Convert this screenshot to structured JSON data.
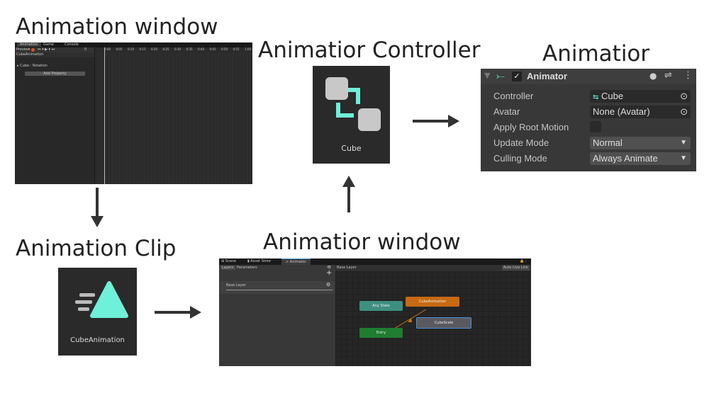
{
  "titles": {
    "animation_window": "Animation window",
    "controller": "Animatior Controller",
    "animator": "Animatior",
    "clip": "Animation Clip",
    "animator_window": "Animatior window"
  },
  "animation_window": {
    "tabs": [
      "Animation",
      "Game",
      "Console"
    ],
    "preview": "Preview",
    "frame": "0",
    "clip_name": "CubeAnimation",
    "property": "Cube : Rotation",
    "add_property": "Add Property",
    "ticks": [
      "0:00",
      "0:05",
      "0:10",
      "0:15",
      "0:20",
      "0:25",
      "0:30",
      "0:35",
      "0:40",
      "0:45",
      "0:50",
      "0:55",
      "1:00"
    ]
  },
  "controller_asset": {
    "name": "Cube",
    "accent": "#6ff0d8"
  },
  "clip_asset": {
    "name": "CubeAnimation",
    "accent": "#6ff0d8"
  },
  "inspector": {
    "component": "Animator",
    "enabled": true,
    "rows": [
      {
        "label": "Controller",
        "value": "Cube"
      },
      {
        "label": "Avatar",
        "value": "None (Avatar)"
      },
      {
        "label": "Apply Root Motion",
        "value": ""
      },
      {
        "label": "Update Mode",
        "value": "Normal"
      },
      {
        "label": "Culling Mode",
        "value": "Always Animate"
      }
    ]
  },
  "animator_window": {
    "tabs": [
      "Scene",
      "Asset Store",
      "Animator"
    ],
    "subtabs": [
      "Layers",
      "Parameters"
    ],
    "breadcrumb": "Base Layer",
    "auto_live_link": "Auto Live Link",
    "layer": "Base Layer",
    "nodes": {
      "any_state": "Any State",
      "entry": "Entry",
      "cube_animation": "CubeAnimation",
      "cube_scale": "CubeScale"
    },
    "colors": {
      "any_state": "#3f8f80",
      "entry": "#1f7d32",
      "default_state": "#c86a12",
      "state": "#5a5a5e"
    }
  }
}
